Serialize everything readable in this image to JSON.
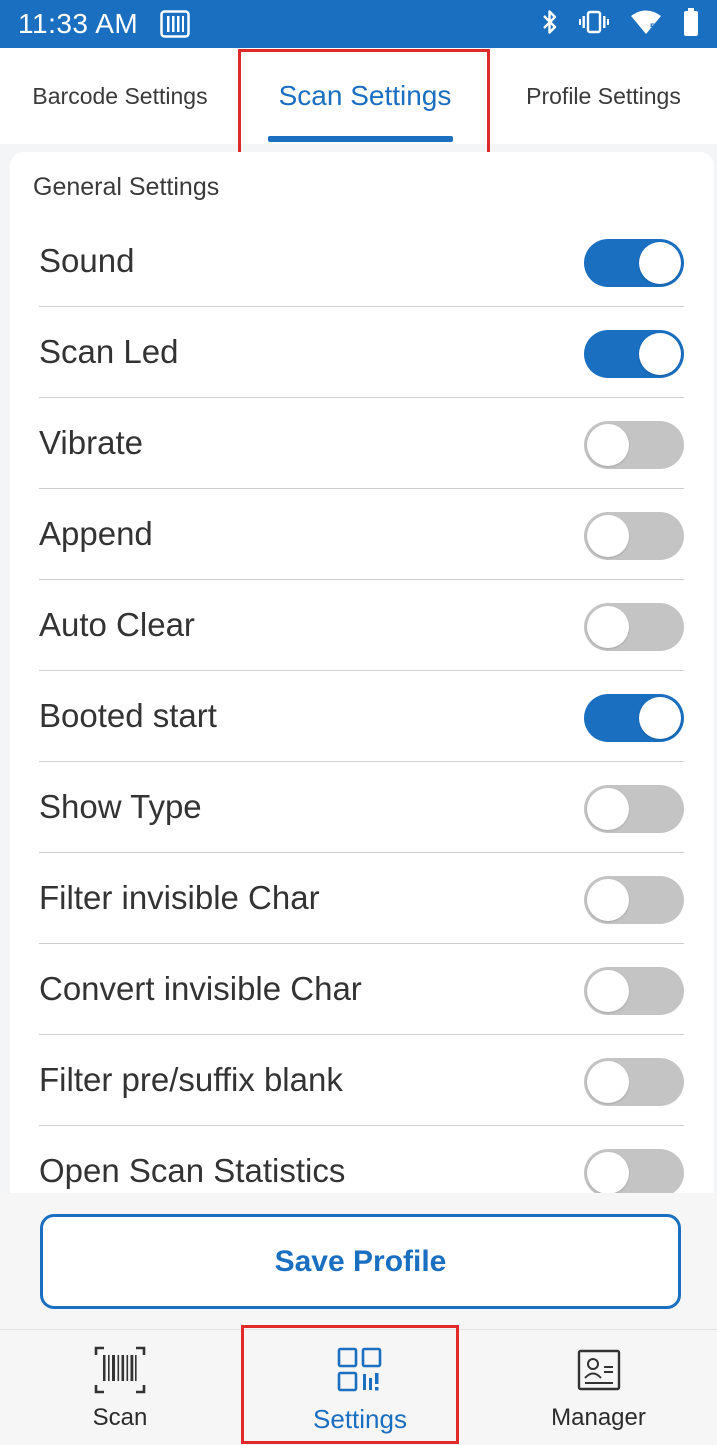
{
  "status_bar": {
    "time": "11:33 AM",
    "icons": [
      "barcode-scanner-icon",
      "bluetooth-icon",
      "vibrate-icon",
      "wifi-icon",
      "battery-icon"
    ]
  },
  "tabs": [
    {
      "label": "Barcode Settings",
      "active": false
    },
    {
      "label": "Scan Settings",
      "active": true
    },
    {
      "label": "Profile Settings",
      "active": false
    }
  ],
  "general_settings": {
    "title": "General Settings",
    "items": [
      {
        "label": "Sound",
        "enabled": true
      },
      {
        "label": "Scan Led",
        "enabled": true
      },
      {
        "label": "Vibrate",
        "enabled": false
      },
      {
        "label": "Append",
        "enabled": false
      },
      {
        "label": "Auto Clear",
        "enabled": false
      },
      {
        "label": "Booted start",
        "enabled": true
      },
      {
        "label": "Show Type",
        "enabled": false
      },
      {
        "label": "Filter invisible Char",
        "enabled": false
      },
      {
        "label": "Convert invisible Char",
        "enabled": false
      },
      {
        "label": "Filter pre/suffix blank",
        "enabled": false
      },
      {
        "label": "Open Scan Statistics",
        "enabled": false
      }
    ]
  },
  "save_button": {
    "label": "Save Profile"
  },
  "bottom_nav": [
    {
      "label": "Scan",
      "icon": "barcode-icon",
      "active": false
    },
    {
      "label": "Settings",
      "icon": "qr-settings-icon",
      "active": true
    },
    {
      "label": "Manager",
      "icon": "contact-card-icon",
      "active": false
    }
  ],
  "colors": {
    "accent": "#1a6fc0",
    "highlight": "#e02a2a",
    "toggle_off": "#c4c4c4"
  }
}
